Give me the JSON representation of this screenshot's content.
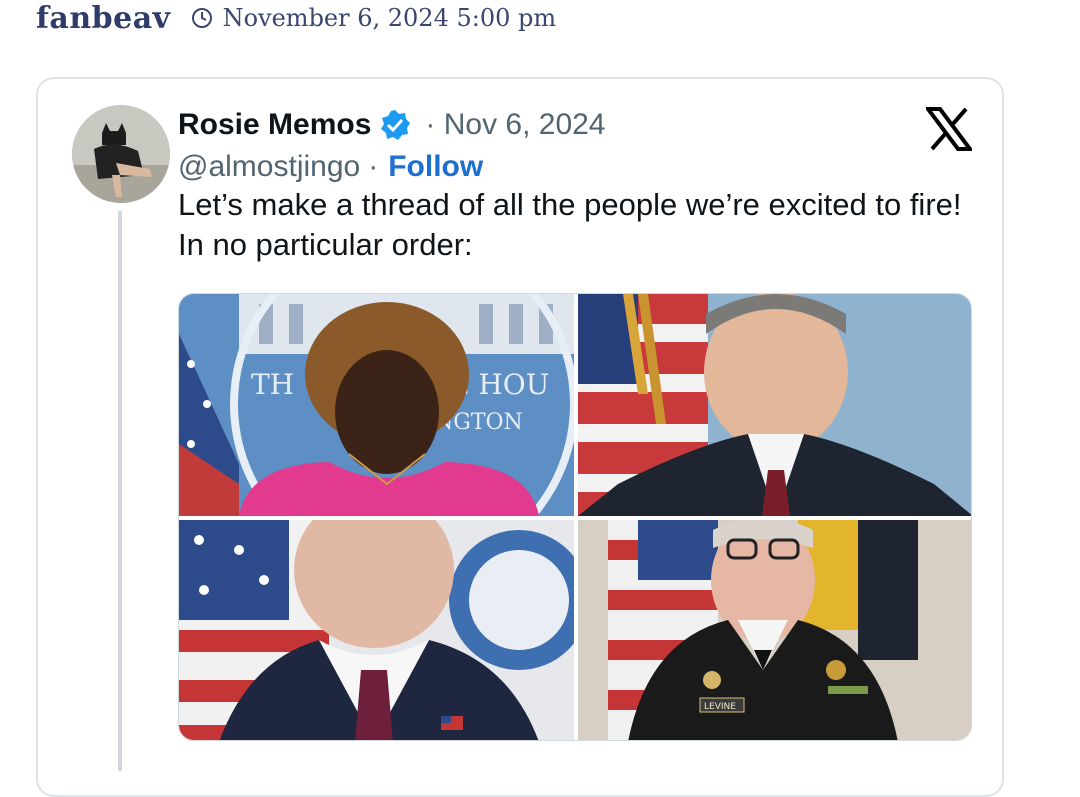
{
  "header": {
    "author": "fanbeav",
    "date": "November 6, 2024 5:00 pm",
    "clock_icon": "clock-icon"
  },
  "tweet": {
    "name": "Rosie Memos",
    "verified_icon": "verified-badge-icon",
    "date": "· Nov 6, 2024",
    "handle": "@almostjingo",
    "separator": "·",
    "follow_label": "Follow",
    "platform_icon": "x-logo-icon",
    "text": "Let’s make a thread of all the people we’re excited to fire! In no particular order:",
    "photos": [
      {
        "name": "photo-1",
        "sign_text_1": "TH",
        "sign_text_2": "E HOU",
        "sign_text_3": "NGTON"
      },
      {
        "name": "photo-2"
      },
      {
        "name": "photo-3"
      },
      {
        "name": "photo-4",
        "name_tag": "LEVINE"
      }
    ]
  },
  "colors": {
    "author": "#2f3b6b",
    "follow": "#1d6fd0",
    "verified": "#1d9bf0",
    "border": "#dfe3e8"
  }
}
